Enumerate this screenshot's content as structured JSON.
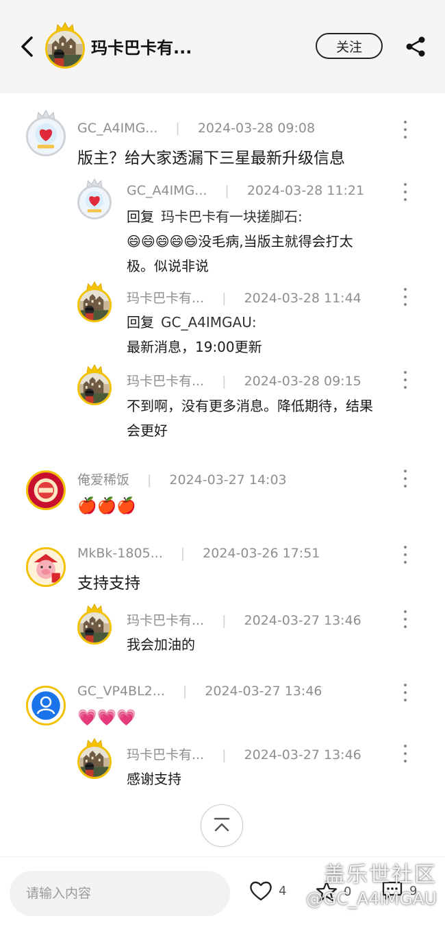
{
  "header": {
    "title": "玛卡巴卡有...",
    "follow_label": "关注"
  },
  "comments": [
    {
      "author": "GC_A4IMG...",
      "time": "2024-03-28 09:08",
      "text": "版主？给大家透漏下三星最新升级信息",
      "avatar": "heart-badge",
      "replies": [
        {
          "author": "GC_A4IMG...",
          "time": "2024-03-28 11:21",
          "reply_prefix": "回复",
          "reply_target": "玛卡巴卡有一块搓脚石:",
          "line1": "😄😄😄😄😄没毛病,当版主就得会打太",
          "line2": "极。似说非说",
          "avatar": "heart-badge"
        },
        {
          "author": "玛卡巴卡有...",
          "time": "2024-03-28 11:44",
          "reply_prefix": "回复",
          "reply_target": "GC_A4IMGAU:",
          "line1": "最新消息，19:00更新",
          "avatar": "castle"
        },
        {
          "author": "玛卡巴卡有...",
          "time": "2024-03-28 09:15",
          "line1": "不到啊，没有更多消息。降低期待，结果",
          "line2": "会更好",
          "avatar": "castle"
        }
      ]
    },
    {
      "author": "俺爱稀饭",
      "time": "2024-03-27 14:03",
      "text": "🍎🍎🍎",
      "avatar": "new-year"
    },
    {
      "author": "MkBk-1805...",
      "time": "2024-03-26 17:51",
      "text": "支持支持",
      "avatar": "pig",
      "replies": [
        {
          "author": "玛卡巴卡有...",
          "time": "2024-03-27 13:46",
          "line1": "我会加油的",
          "avatar": "castle"
        }
      ]
    },
    {
      "author": "GC_VP4BL2...",
      "time": "2024-03-27 13:46",
      "text": "💗💗💗",
      "avatar": "default-user",
      "replies": [
        {
          "author": "玛卡巴卡有...",
          "time": "2024-03-27 13:46",
          "line1": "感谢支持",
          "avatar": "castle"
        }
      ]
    }
  ],
  "bottom": {
    "input_placeholder": "请输入内容",
    "like_count": "4",
    "favorite_count": "0",
    "comment_count": "9"
  },
  "watermark": {
    "line1": "盖乐世社区",
    "line2": "@GC_A4IMGAU"
  },
  "colors": {
    "accent_gold": "#f2c100",
    "header_bg": "#f5f5f5",
    "meta_gray": "#8e8e8e"
  }
}
